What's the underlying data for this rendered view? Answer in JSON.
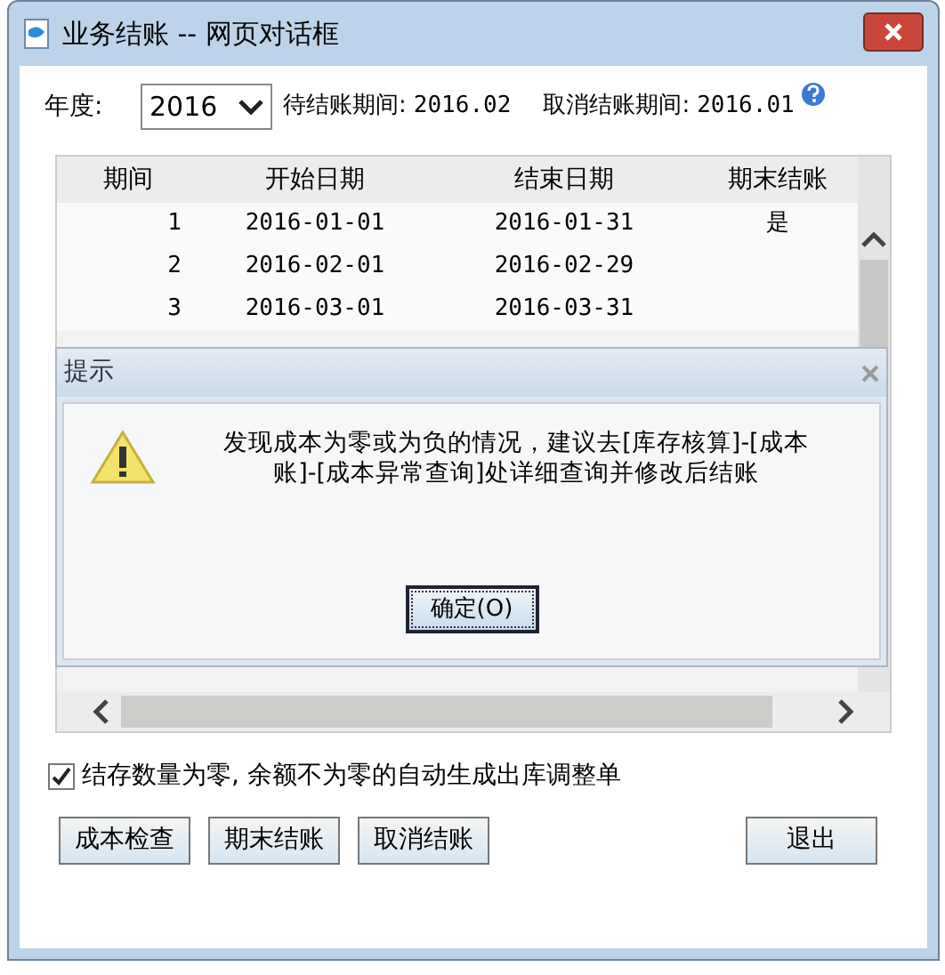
{
  "window": {
    "title": "业务结账 -- 网页对话框"
  },
  "year": {
    "label": "年度:",
    "value": "2016"
  },
  "pending_period": {
    "label": "待结账期间:",
    "value": "2016.02"
  },
  "cancel_period": {
    "label": "取消结账期间:",
    "value": "2016.01"
  },
  "table": {
    "columns": [
      "期间",
      "开始日期",
      "结束日期",
      "期末结账"
    ],
    "rows": [
      {
        "cells": [
          "1",
          "2016-01-01",
          "2016-01-31",
          "是"
        ]
      },
      {
        "cells": [
          "2",
          "2016-02-01",
          "2016-02-29",
          ""
        ]
      },
      {
        "cells": [
          "3",
          "2016-03-01",
          "2016-03-31",
          ""
        ]
      }
    ]
  },
  "option": {
    "label": "结存数量为零, 余额不为零的自动生成出库调整单",
    "checked": true
  },
  "buttons": [
    {
      "label": "成本检查",
      "kind": "left"
    },
    {
      "label": "期末结账",
      "kind": "left"
    },
    {
      "label": "取消结账",
      "kind": "left"
    },
    {
      "label": "退出",
      "kind": "right"
    }
  ],
  "alert": {
    "title": "提示",
    "message": "发现成本为零或为负的情况，建议去[库存核算]-[成本账]-[成本异常查询]处详细查询并修改后结账",
    "button": "确定(O)"
  }
}
